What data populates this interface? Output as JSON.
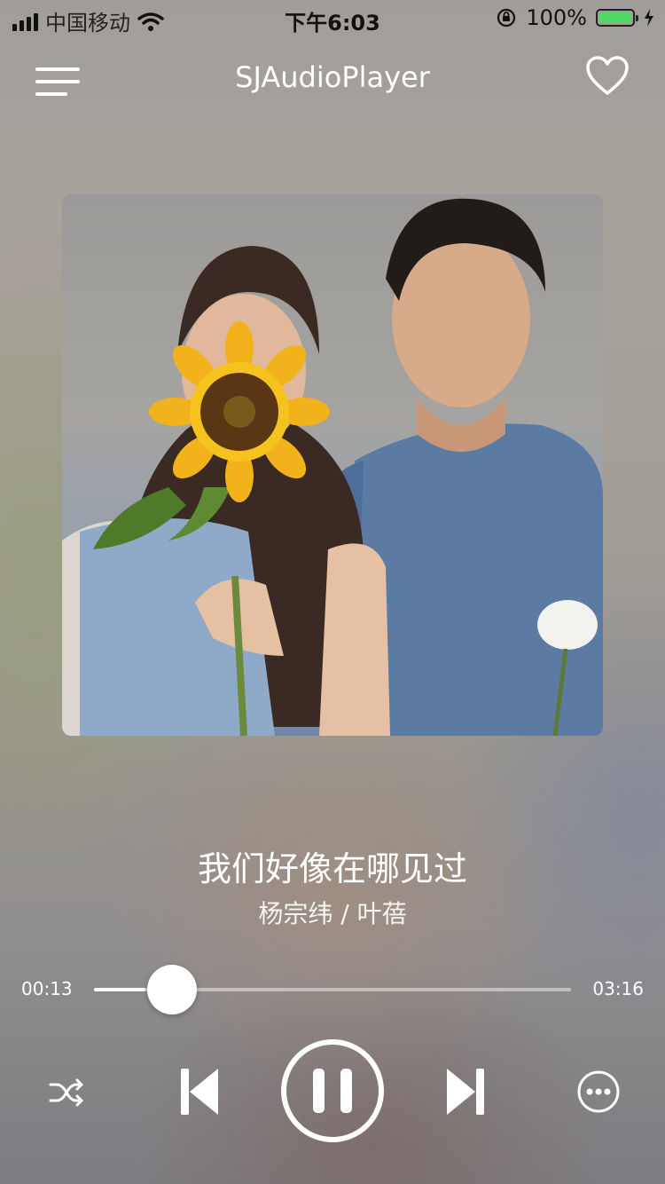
{
  "status_bar": {
    "carrier": "中国移动",
    "time": "下午6:03",
    "battery": "100%"
  },
  "nav": {
    "title": "SJAudioPlayer"
  },
  "track": {
    "title": "我们好像在哪见过",
    "artist": "杨宗纬 / 叶蓓"
  },
  "progress": {
    "current": "00:13",
    "total": "03:16",
    "played_fraction": 0.107
  },
  "colors": {
    "battery_fill": "#4cd964"
  },
  "icons": {
    "menu": "menu-icon",
    "favorite": "heart-icon",
    "shuffle": "shuffle-icon",
    "previous": "previous-icon",
    "pause": "pause-icon",
    "next": "next-icon",
    "more": "more-icon"
  }
}
